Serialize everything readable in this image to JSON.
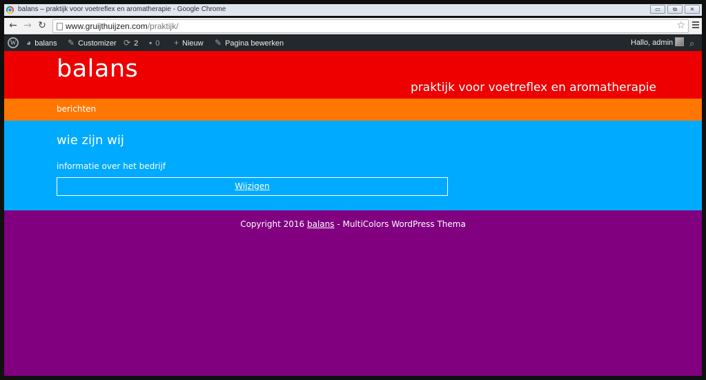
{
  "window": {
    "title": "balans – praktijk voor voetreflex en aromatherapie - Google Chrome",
    "buttons": [
      "▭",
      "⧉",
      "✕"
    ]
  },
  "browser": {
    "url_host": "www.gruijthuijzen.com",
    "url_path": "/praktijk/"
  },
  "adminbar": {
    "site_name": "balans",
    "customizer": "Customizer",
    "updates_count": "2",
    "comments_count": "0",
    "new_label": "Nieuw",
    "edit_page": "Pagina bewerken",
    "greeting": "Hallo, admin"
  },
  "site": {
    "title": "balans",
    "tagline": "praktijk voor voetreflex en aromatherapie",
    "nav": [
      "berichten"
    ],
    "page_title": "wie zijn wij",
    "page_text": "informatie over het bedrijf",
    "edit_link": "Wijzigen",
    "footer_prefix": "Copyright 2016 ",
    "footer_link": "balans",
    "footer_suffix": " - MultiColors WordPress Thema"
  },
  "colors": {
    "header": "#ee0000",
    "nav": "#ff7700",
    "content": "#00aaff",
    "footer": "#800080",
    "adminbar": "#23282d"
  }
}
